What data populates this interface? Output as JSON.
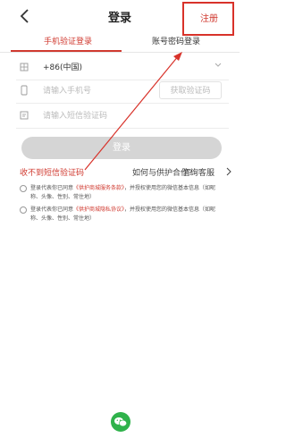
{
  "header": {
    "title": "登录",
    "register_label": "注册"
  },
  "tabs": [
    {
      "label": "手机验证登录",
      "active": true
    },
    {
      "label": "账号密码登录",
      "active": false
    }
  ],
  "form": {
    "country_code": "+86(中国)",
    "phone_placeholder": "请输入手机号",
    "get_code_label": "获取验证码",
    "sms_placeholder": "请输入短信验证码"
  },
  "login_button": "登录",
  "links": {
    "no_code": "收不到短信验证码",
    "help": "如何与供护合作?",
    "consult": "咨询客服"
  },
  "agreements": [
    {
      "prefix": "登录代表你已同意",
      "link": "《供护商城服务条款》",
      "suffix": "，并授权使用您的微信基本信息（如昵称、头像、性别、常住地）"
    },
    {
      "prefix": "登录代表你已同意",
      "link": "《供护商城隐私协议》",
      "suffix": "，并授权使用您的微信基本信息（如昵称、头像、性别、常住地）"
    }
  ],
  "colors": {
    "accent": "#d03a30",
    "annotation": "#d8322a",
    "wechat": "#2fb24b"
  }
}
